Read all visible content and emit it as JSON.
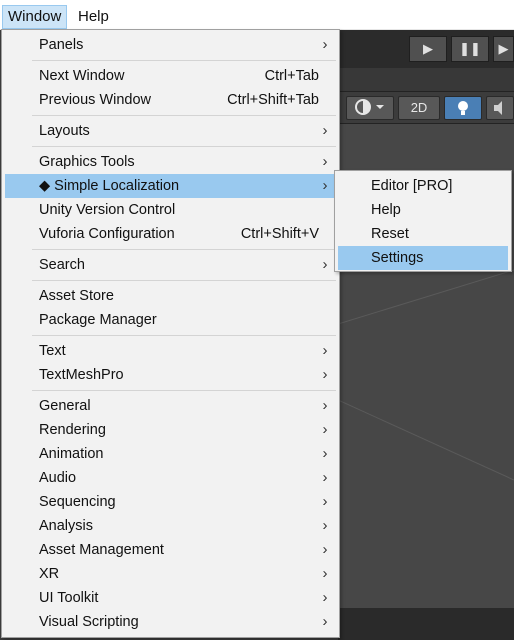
{
  "menubar": {
    "items": [
      {
        "label": "Window",
        "open": true
      },
      {
        "label": "Help",
        "open": false
      }
    ]
  },
  "editor": {
    "play_controls": [
      "▶",
      "❚❚",
      "▶"
    ],
    "scene_buttons": [
      "2D"
    ],
    "accent_color": "#4a7fb5"
  },
  "window_menu": {
    "items": [
      {
        "label": "Panels",
        "submenu": true
      },
      {
        "label": "Next Window",
        "shortcut": "Ctrl+Tab"
      },
      {
        "label": "Previous Window",
        "shortcut": "Ctrl+Shift+Tab"
      },
      {
        "label": "Layouts",
        "submenu": true
      },
      {
        "label": "Graphics Tools",
        "submenu": true
      },
      {
        "label": "◆ Simple Localization",
        "submenu": true,
        "highlighted": true
      },
      {
        "label": "Unity Version Control"
      },
      {
        "label": "Vuforia Configuration",
        "shortcut": "Ctrl+Shift+V"
      },
      {
        "label": "Search",
        "submenu": true
      },
      {
        "label": "Asset Store"
      },
      {
        "label": "Package Manager"
      },
      {
        "label": "Text",
        "submenu": true
      },
      {
        "label": "TextMeshPro",
        "submenu": true
      },
      {
        "label": "General",
        "submenu": true
      },
      {
        "label": "Rendering",
        "submenu": true
      },
      {
        "label": "Animation",
        "submenu": true
      },
      {
        "label": "Audio",
        "submenu": true
      },
      {
        "label": "Sequencing",
        "submenu": true
      },
      {
        "label": "Analysis",
        "submenu": true
      },
      {
        "label": "Asset Management",
        "submenu": true
      },
      {
        "label": "XR",
        "submenu": true
      },
      {
        "label": "UI Toolkit",
        "submenu": true
      },
      {
        "label": "Visual Scripting",
        "submenu": true
      }
    ],
    "submenu_arrow": "›"
  },
  "localization_submenu": {
    "items": [
      {
        "label": "Editor [PRO]"
      },
      {
        "label": "Help"
      },
      {
        "label": "Reset"
      },
      {
        "label": "Settings",
        "highlighted": true
      }
    ]
  },
  "colors": {
    "menu_bg": "#f2f2f2",
    "highlight": "#99c9ef",
    "menubar_open": "#cce4f7"
  }
}
